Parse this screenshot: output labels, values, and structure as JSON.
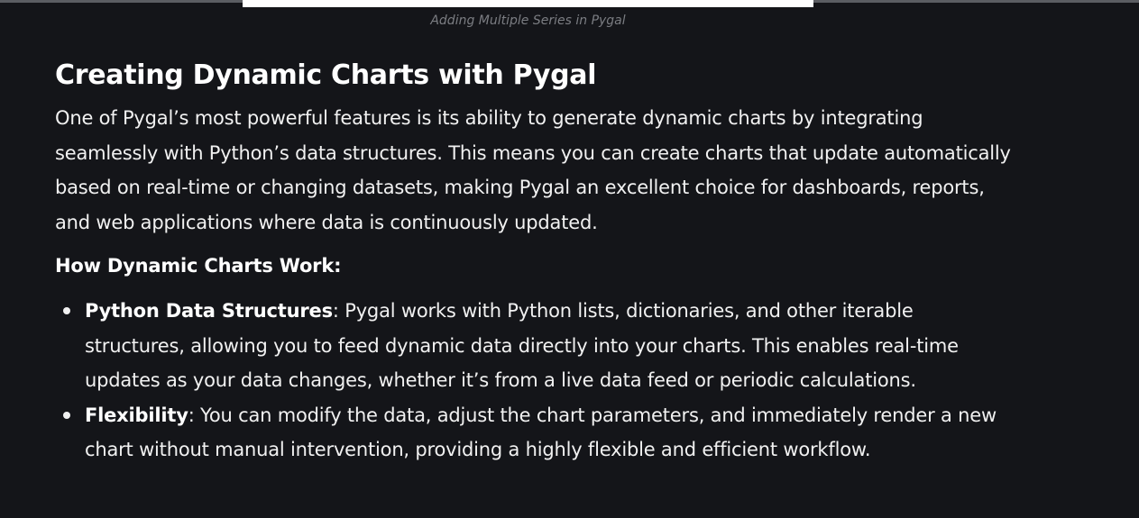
{
  "figure": {
    "caption": "Adding Multiple Series in Pygal"
  },
  "article": {
    "heading": "Creating Dynamic Charts with Pygal",
    "intro": "One of Pygal’s most powerful features is its ability to generate dynamic charts by integrating seamlessly with Python’s data structures. This means you can create charts that update automatically based on real-time or changing datasets, making Pygal an excellent choice for dashboards, reports, and web applications where data is continuously updated.",
    "subheading": "How Dynamic Charts Work:",
    "bullets": [
      {
        "term": "Python Data Structures",
        "text": ": Pygal works with Python lists, dictionaries, and other iterable structures, allowing you to feed dynamic data directly into your charts. This enables real-time updates as your data changes, whether it’s from a live data feed or periodic calculations."
      },
      {
        "term": "Flexibility",
        "text": ": You can modify the data, adjust the chart parameters, and immediately render a new chart without manual intervention, providing a highly flexible and efficient workflow."
      }
    ]
  }
}
